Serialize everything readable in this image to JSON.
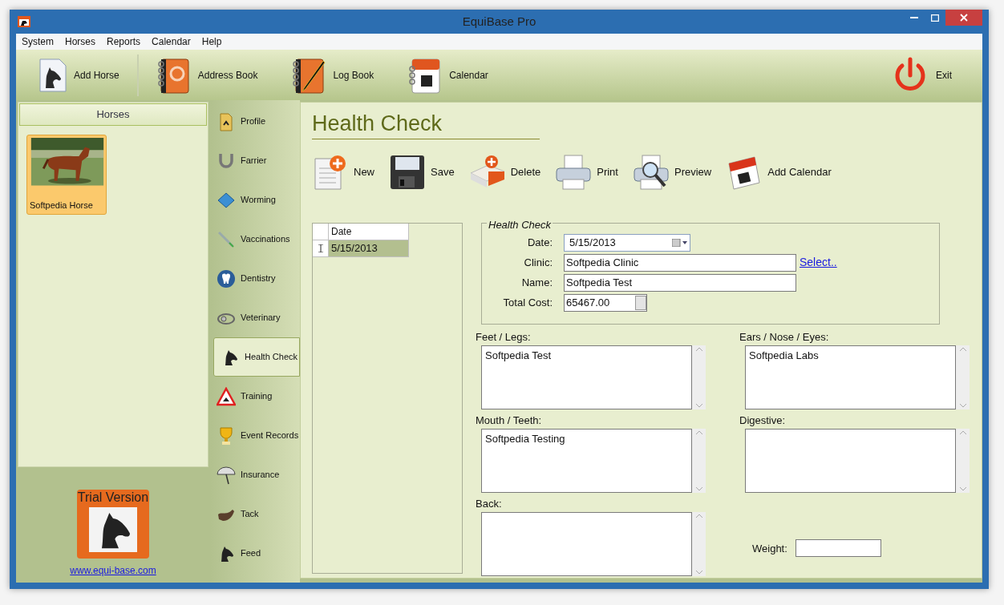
{
  "window": {
    "title": "EquiBase Pro"
  },
  "menu": [
    "System",
    "Horses",
    "Reports",
    "Calendar",
    "Help"
  ],
  "toolbar": [
    {
      "label": "Add Horse",
      "kind": "horse"
    },
    {
      "label": "Address Book",
      "kind": "address"
    },
    {
      "label": "Log Book",
      "kind": "log"
    },
    {
      "label": "Calendar",
      "kind": "calendar"
    },
    {
      "label": "Exit",
      "kind": "exit"
    }
  ],
  "horses_panel": {
    "title": "Horses",
    "horses": [
      {
        "name": "Softpedia Horse",
        "selected": true
      }
    ]
  },
  "trial": {
    "label": "Trial Version",
    "link": "www.equi-base.com"
  },
  "nav": [
    {
      "label": "Profile",
      "kind": "folder",
      "selected": false
    },
    {
      "label": "Farrier",
      "kind": "horseshoe",
      "selected": false
    },
    {
      "label": "Worming",
      "kind": "book",
      "selected": false
    },
    {
      "label": "Vaccinations",
      "kind": "syringe",
      "selected": false
    },
    {
      "label": "Dentistry",
      "kind": "tooth",
      "selected": false
    },
    {
      "label": "Veterinary",
      "kind": "stethoscope",
      "selected": false
    },
    {
      "label": "Health Check",
      "kind": "horse",
      "selected": true
    },
    {
      "label": "Training",
      "kind": "warning",
      "selected": false
    },
    {
      "label": "Event Records",
      "kind": "trophy",
      "selected": false
    },
    {
      "label": "Insurance",
      "kind": "umbrella",
      "selected": false
    },
    {
      "label": "Tack",
      "kind": "saddle",
      "selected": false
    },
    {
      "label": "Feed",
      "kind": "horse",
      "selected": false
    }
  ],
  "page_title": "Health Check",
  "actions": [
    {
      "label": "New",
      "kind": "new"
    },
    {
      "label": "Save",
      "kind": "save"
    },
    {
      "label": "Delete",
      "kind": "delete"
    },
    {
      "label": "Print",
      "kind": "print"
    },
    {
      "label": "Preview",
      "kind": "preview"
    },
    {
      "label": "Add Calendar",
      "kind": "calendar"
    }
  ],
  "grid": {
    "columns": [
      "Date"
    ],
    "rows": [
      {
        "date": "5/15/2013",
        "selected": true
      }
    ]
  },
  "form": {
    "legend": "Health Check",
    "date": {
      "label": "Date:",
      "value": "5/15/2013"
    },
    "clinic": {
      "label": "Clinic:",
      "value": "Softpedia Clinic",
      "link": "Select.."
    },
    "name": {
      "label": "Name:",
      "value": "Softpedia Test"
    },
    "cost": {
      "label": "Total Cost:",
      "value": "65467.00"
    }
  },
  "notes": [
    {
      "label": "Feet / Legs:",
      "value": "Softpedia Test"
    },
    {
      "label": "Ears / Nose / Eyes:",
      "value": "Softpedia Labs"
    },
    {
      "label": "Mouth / Teeth:",
      "value": "Softpedia Testing"
    },
    {
      "label": "Digestive:"
    },
    {
      "label": "Back:"
    }
  ],
  "weight": {
    "label": "Weight:"
  }
}
